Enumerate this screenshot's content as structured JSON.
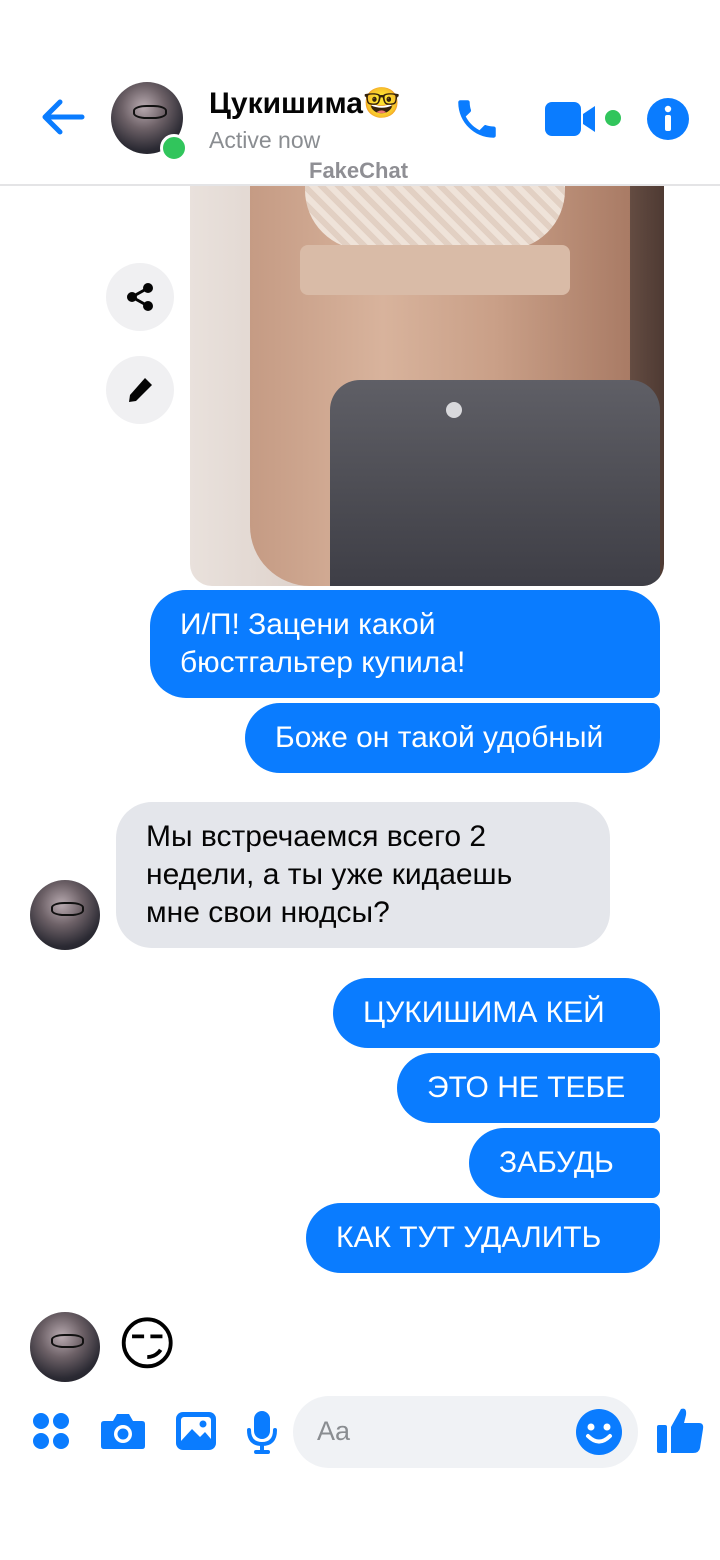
{
  "header": {
    "contact_name": "Цукишима🤓",
    "status": "Active now",
    "watermark": "FakeChat",
    "icons": [
      "back-arrow-icon",
      "phone-icon",
      "video-camera-icon",
      "info-icon"
    ]
  },
  "chat": {
    "shared_photo": "photo-message",
    "actions": [
      "share-icon",
      "pencil-icon"
    ],
    "messages": [
      {
        "direction": "outgoing",
        "text": "И/П! Зацени какой\nбюстгальтер купила!"
      },
      {
        "direction": "outgoing",
        "text": "Боже он такой удобный"
      },
      {
        "direction": "incoming",
        "text": "Мы встречаемся всего 2\nнедели, а ты уже кидаешь\nмне свои нюдсы?"
      },
      {
        "direction": "outgoing",
        "text": "ЦУКИШИМА КЕЙ"
      },
      {
        "direction": "outgoing",
        "text": "ЭТО НЕ ТЕБЕ"
      },
      {
        "direction": "outgoing",
        "text": "ЗАБУДЬ"
      },
      {
        "direction": "outgoing",
        "text": "КАК ТУТ УДАЛИТЬ"
      }
    ],
    "reaction_emoji": "😏"
  },
  "composer": {
    "placeholder": "Aa",
    "icons": [
      "apps-icon",
      "camera-icon",
      "gallery-icon",
      "microphone-icon",
      "smile-icon",
      "thumbs-up-icon"
    ]
  },
  "colors": {
    "accent": "#0a7cff",
    "online": "#31c55c",
    "incoming_bubble": "#e4e6eb"
  }
}
